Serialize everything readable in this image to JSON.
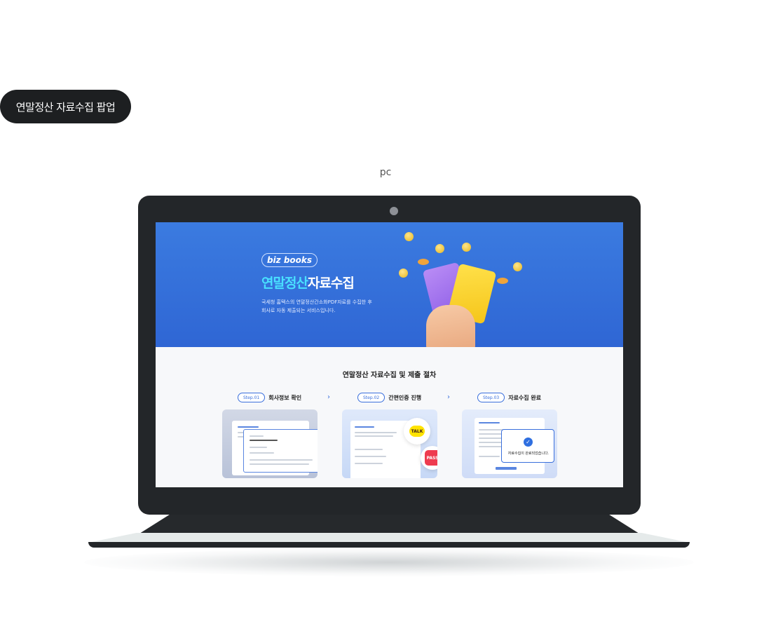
{
  "header": {
    "pill_label": "연말정산 자료수집 팝업",
    "device_label": "pc"
  },
  "hero": {
    "logo": "biz books",
    "title_highlight": "연말정산",
    "title_rest": "자료수집",
    "desc_line1": "국세청 홈택스의 연말정산간소화PDF자료를 수집한 후",
    "desc_line2": "회사로 자동 제출되는 서비스입니다."
  },
  "process": {
    "title": "연말정산 자료수집 및 제출 절차",
    "steps": [
      {
        "badge": "Step.01",
        "label": "회사정보 확인"
      },
      {
        "badge": "Step.02",
        "label": "간편인증 진행"
      },
      {
        "badge": "Step.03",
        "label": "자료수집 완료"
      }
    ],
    "arrow": "›"
  },
  "thumbs": {
    "auth_badges": [
      "TALK",
      "PASS"
    ],
    "done_check": "✓",
    "done_text": "자료수집이 완료되었습니다."
  },
  "colors": {
    "accent": "#3a6fdc",
    "hero_bg": "#3b7be0",
    "highlight": "#49e0ff",
    "laptop": "#232629"
  }
}
